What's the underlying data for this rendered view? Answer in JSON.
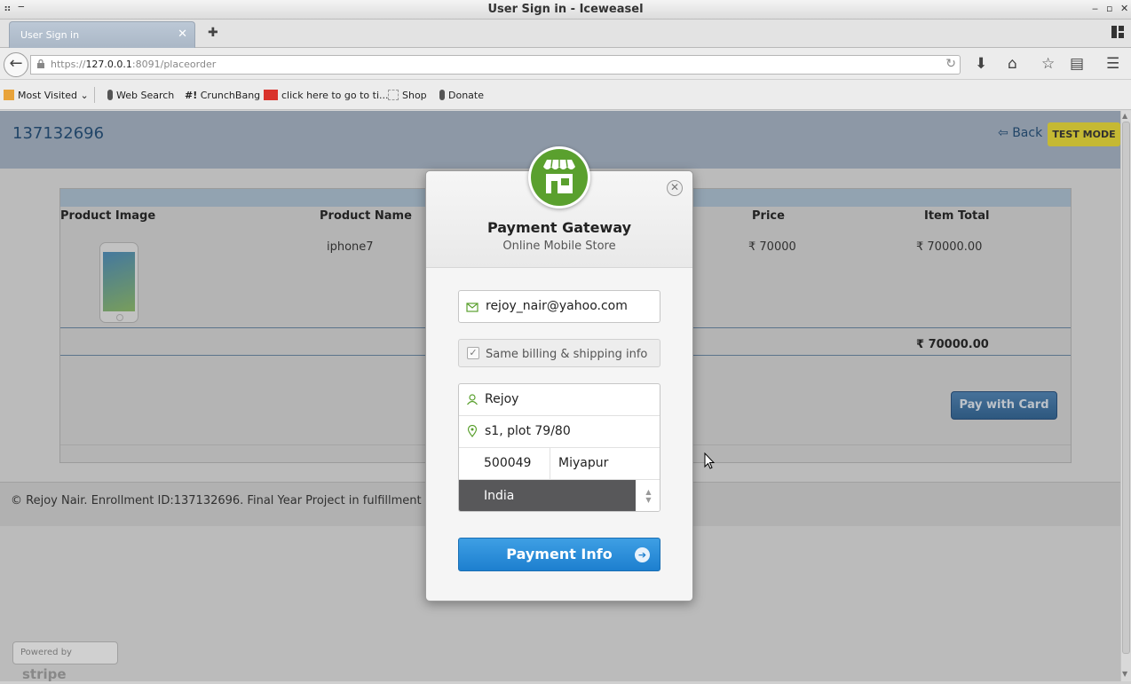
{
  "window": {
    "title": "User Sign in - Iceweasel"
  },
  "tab": {
    "title": "User Sign in"
  },
  "urlbar": {
    "url_prefix": "https://",
    "url_host": "127.0.0.1",
    "url_rest": ":8091/placeorder"
  },
  "bookmarks": {
    "items": [
      "Most Visited",
      "Web Search",
      "CrunchBang",
      "click here to go to ti...",
      "Shop",
      "Donate"
    ]
  },
  "page": {
    "order_id": "137132696",
    "back_label": "Back",
    "test_mode_label": "TEST MODE",
    "table": {
      "headers": [
        "Product Image",
        "Product Name",
        "Price",
        "Item Total"
      ],
      "row": {
        "name": "iphone7",
        "price": "₹ 70000",
        "item_total": "₹ 70000.00"
      },
      "grand_total": "₹ 70000.00"
    },
    "pay_button_label": "Pay with Card",
    "footer_text": "© Rejoy Nair. Enrollment ID:137132696. Final Year Project in fulfillment of",
    "powered_by": "Powered by",
    "powered_brand": "stripe"
  },
  "modal": {
    "title": "Payment Gateway",
    "subtitle": "Online Mobile Store",
    "email": "rejoy_nair@yahoo.com",
    "same_billing_label": "Same billing & shipping info",
    "same_billing_checked": true,
    "name": "Rejoy",
    "address": "s1, plot 79/80",
    "zip": "500049",
    "city": "Miyapur",
    "country": "India",
    "submit_label": "Payment Info"
  },
  "colors": {
    "accent_blue": "#1d7fcf",
    "logo_green": "#5aa02e",
    "test_mode_yellow": "#f1e236",
    "header_blue": "#a9b8c9"
  },
  "icons": [
    "back-arrow-icon",
    "lock-icon",
    "reload-icon",
    "download-icon",
    "home-icon",
    "bookmark-star-icon",
    "reading-list-icon",
    "menu-icon",
    "store-icon",
    "close-icon",
    "envelope-icon",
    "user-icon",
    "location-pin-icon",
    "arrow-right-icon"
  ]
}
